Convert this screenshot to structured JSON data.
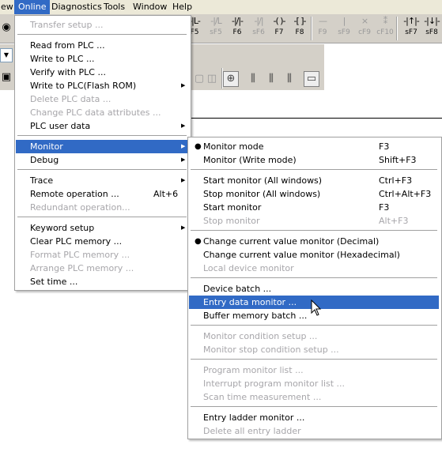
{
  "menubar": {
    "items": [
      "ew",
      "Online",
      "Diagnostics",
      "Tools",
      "Window",
      "Help"
    ]
  },
  "toolbar": {
    "fkeys": [
      {
        "glyph": "-|L-",
        "label": "F5",
        "gray": false
      },
      {
        "glyph": "-|/L",
        "label": "sF5",
        "gray": true
      },
      {
        "glyph": "-|/|-",
        "label": "F6",
        "gray": false
      },
      {
        "glyph": "-|/|",
        "label": "sF6",
        "gray": true
      },
      {
        "glyph": "-( )-",
        "label": "F7",
        "gray": false
      },
      {
        "glyph": "-[ ]-",
        "label": "F8",
        "gray": false
      },
      {
        "glyph": "—",
        "label": "F9",
        "gray": true
      },
      {
        "glyph": "|",
        "label": "sF9",
        "gray": true
      },
      {
        "glyph": "×",
        "label": "cF9",
        "gray": true
      },
      {
        "glyph": "⁑",
        "label": "cF10",
        "gray": true
      },
      {
        "glyph": "-|↑|-",
        "label": "sF7",
        "gray": false
      },
      {
        "glyph": "-|↓|-",
        "label": "sF8",
        "gray": false
      }
    ]
  },
  "online_menu": {
    "items": [
      {
        "type": "item",
        "label": "Transfer setup ...",
        "disabled": true
      },
      {
        "type": "sep"
      },
      {
        "type": "item",
        "label": "Read from PLC ..."
      },
      {
        "type": "item",
        "label": "Write to PLC ..."
      },
      {
        "type": "item",
        "label": "Verify with PLC ..."
      },
      {
        "type": "item",
        "label": "Write to PLC(Flash ROM)",
        "submenu": true
      },
      {
        "type": "item",
        "label": "Delete PLC data ...",
        "disabled": true
      },
      {
        "type": "item",
        "label": "Change PLC data attributes ...",
        "disabled": true
      },
      {
        "type": "item",
        "label": "PLC user data",
        "submenu": true
      },
      {
        "type": "sep"
      },
      {
        "type": "item",
        "label": "Monitor",
        "submenu": true,
        "highlighted": true
      },
      {
        "type": "item",
        "label": "Debug",
        "submenu": true
      },
      {
        "type": "sep"
      },
      {
        "type": "item",
        "label": "Trace",
        "submenu": true
      },
      {
        "type": "item",
        "label": "Remote operation ...",
        "shortcut": "Alt+6"
      },
      {
        "type": "item",
        "label": "Redundant operation...",
        "disabled": true
      },
      {
        "type": "sep"
      },
      {
        "type": "item",
        "label": "Keyword setup",
        "submenu": true
      },
      {
        "type": "item",
        "label": "Clear PLC memory ..."
      },
      {
        "type": "item",
        "label": "Format PLC memory ...",
        "disabled": true
      },
      {
        "type": "item",
        "label": "Arrange PLC memory ...",
        "disabled": true
      },
      {
        "type": "item",
        "label": "Set time ..."
      }
    ]
  },
  "monitor_menu": {
    "items": [
      {
        "type": "item",
        "label": "Monitor mode",
        "shortcut": "F3",
        "checked": true
      },
      {
        "type": "item",
        "label": "Monitor (Write mode)",
        "shortcut": "Shift+F3"
      },
      {
        "type": "sep"
      },
      {
        "type": "item",
        "label": "Start monitor (All windows)",
        "shortcut": "Ctrl+F3"
      },
      {
        "type": "item",
        "label": "Stop monitor (All windows)",
        "shortcut": "Ctrl+Alt+F3"
      },
      {
        "type": "item",
        "label": "Start monitor",
        "shortcut": "F3"
      },
      {
        "type": "item",
        "label": "Stop monitor",
        "shortcut": "Alt+F3",
        "disabled": true
      },
      {
        "type": "sep"
      },
      {
        "type": "item",
        "label": "Change current value monitor (Decimal)",
        "checked": true
      },
      {
        "type": "item",
        "label": "Change current value monitor (Hexadecimal)"
      },
      {
        "type": "item",
        "label": "Local device monitor",
        "disabled": true
      },
      {
        "type": "sep"
      },
      {
        "type": "item",
        "label": "Device batch ..."
      },
      {
        "type": "item",
        "label": "Entry data monitor ...",
        "highlighted": true
      },
      {
        "type": "item",
        "label": "Buffer memory batch ..."
      },
      {
        "type": "sep"
      },
      {
        "type": "item",
        "label": "Monitor condition setup ...",
        "disabled": true
      },
      {
        "type": "item",
        "label": "Monitor stop condition setup ...",
        "disabled": true
      },
      {
        "type": "sep"
      },
      {
        "type": "item",
        "label": "Program monitor list ...",
        "disabled": true
      },
      {
        "type": "item",
        "label": "Interrupt program monitor list ...",
        "disabled": true
      },
      {
        "type": "item",
        "label": "Scan time measurement ...",
        "disabled": true
      },
      {
        "type": "sep"
      },
      {
        "type": "item",
        "label": "Entry ladder monitor ..."
      },
      {
        "type": "item",
        "label": "Delete all entry ladder",
        "disabled": true
      }
    ]
  }
}
